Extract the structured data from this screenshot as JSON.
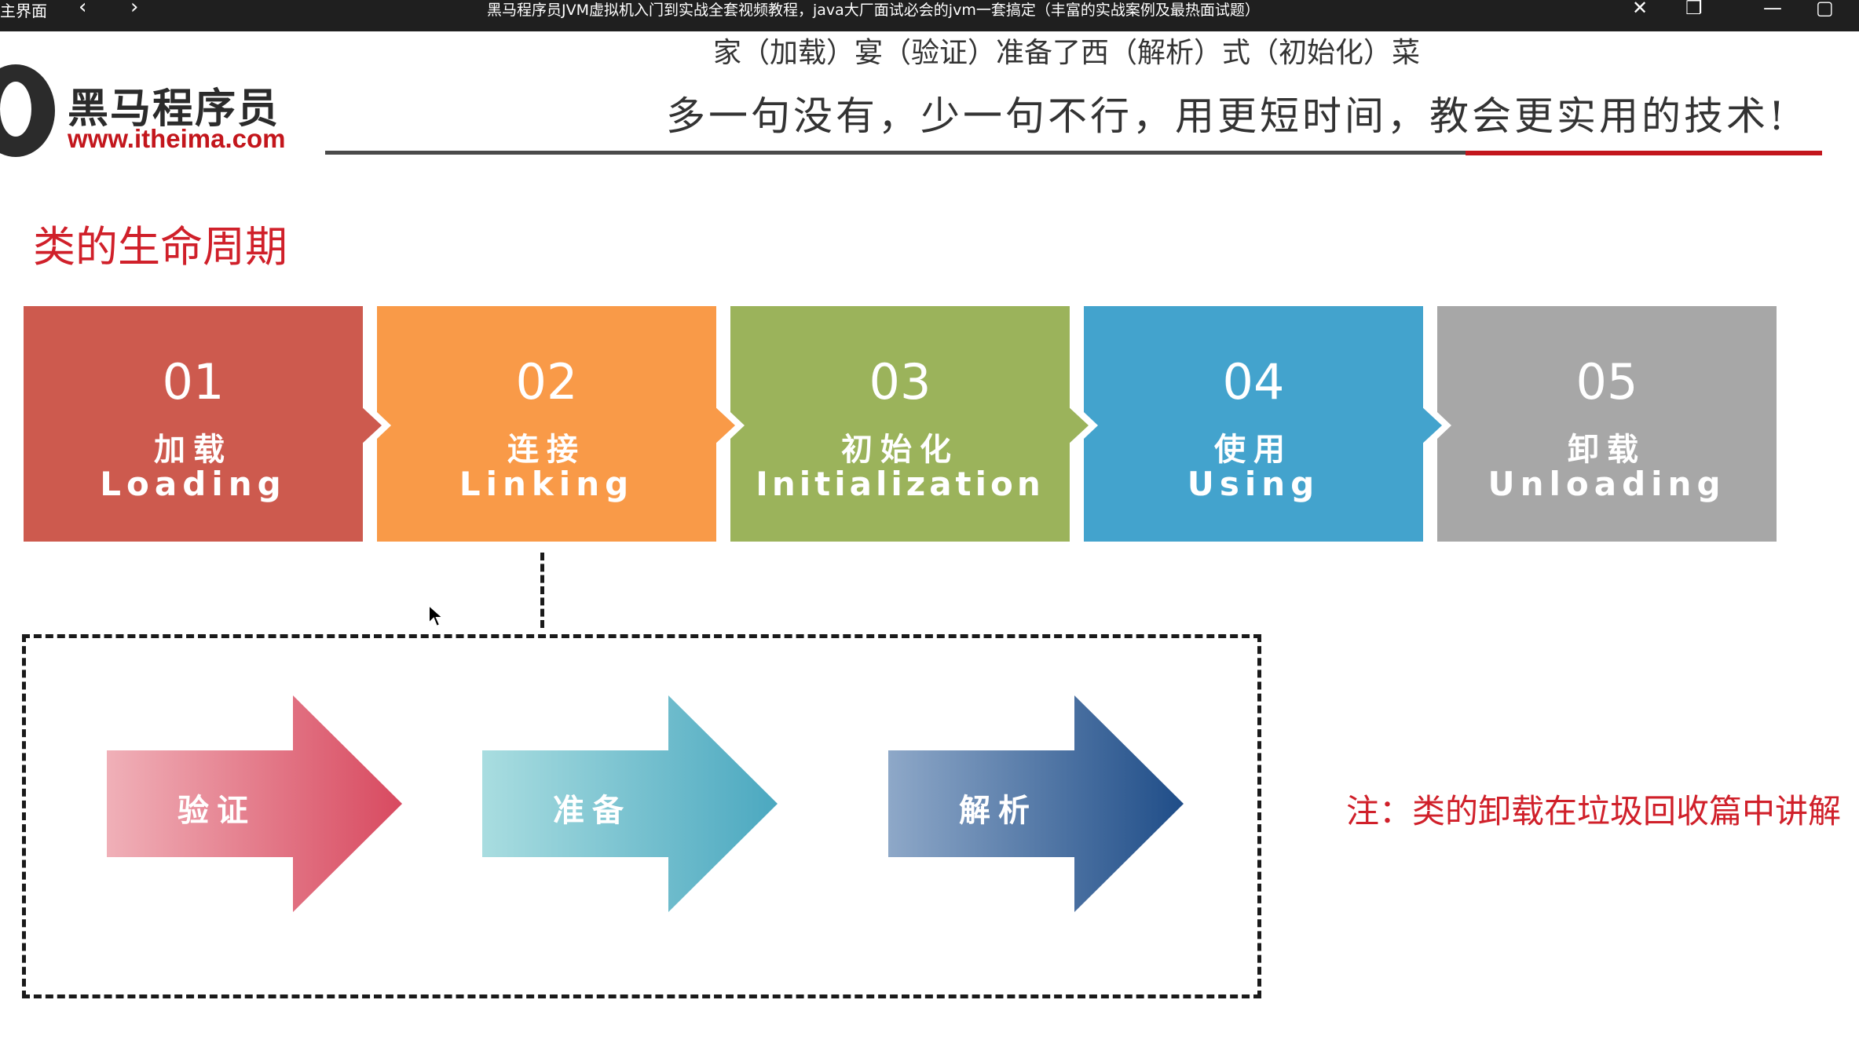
{
  "window": {
    "left_label": "主界面",
    "back_icon": "chevron-left-icon",
    "forward_icon": "chevron-right-icon",
    "title": "黑马程序员JVM虚拟机入门到实战全套视频教程，java大厂面试必会的jvm一套搞定（丰富的实战案例及最热面试题）"
  },
  "caption": "家（加载）宴（验证）准备了西（解析）式（初始化）菜",
  "logo": {
    "name": "黑马程序员",
    "url": "www.itheima.com"
  },
  "slogan": "多一句没有，少一句不行，用更短时间，教会更实用的技术!",
  "section_title": "类的生命周期",
  "stages": [
    {
      "num": "01",
      "cn": "加载",
      "en": "Loading",
      "color": "#cd5a4e"
    },
    {
      "num": "02",
      "cn": "连接",
      "en": "Linking",
      "color": "#f99a48"
    },
    {
      "num": "03",
      "cn": "初始化",
      "en": "Initialization",
      "color": "#9bb35b"
    },
    {
      "num": "04",
      "cn": "使用",
      "en": "Using",
      "color": "#43a3cd"
    },
    {
      "num": "05",
      "cn": "卸载",
      "en": "Unloading",
      "color": "#a7a7a7"
    }
  ],
  "linking_steps": [
    {
      "label": "验证",
      "from": "#f0b0b8",
      "to": "#d84a60"
    },
    {
      "label": "准备",
      "from": "#a9dde0",
      "to": "#4ba8c0"
    },
    {
      "label": "解析",
      "from": "#8ea8c8",
      "to": "#1f4d88"
    }
  ],
  "note": "注：类的卸载在垃圾回收篇中讲解",
  "colors": {
    "accent_red": "#d0202a",
    "brand_red": "#c3161c"
  }
}
